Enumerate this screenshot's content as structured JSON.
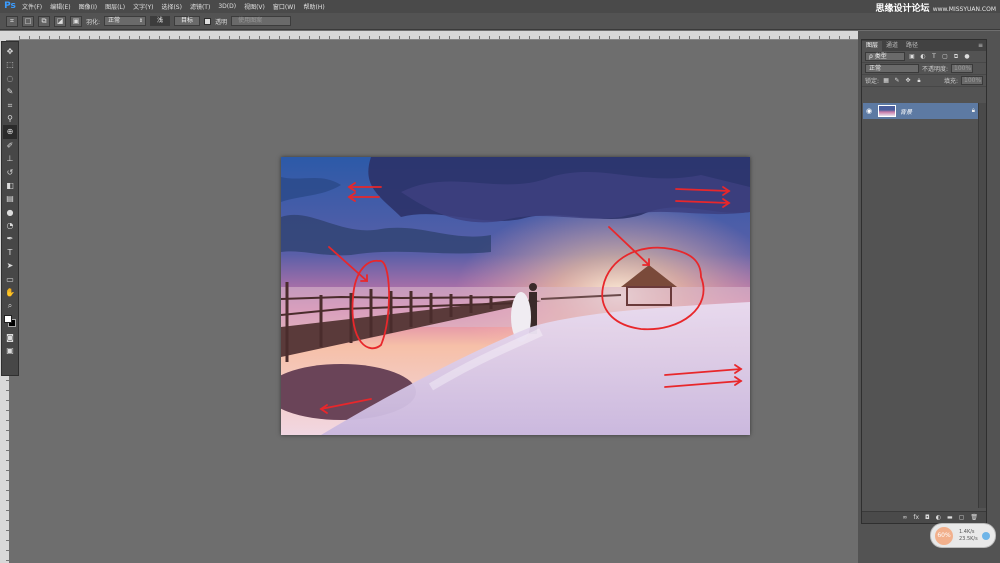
{
  "app": {
    "logo": "Ps"
  },
  "menu": [
    "文件(F)",
    "编辑(E)",
    "图像(I)",
    "图层(L)",
    "文字(Y)",
    "选择(S)",
    "滤镜(T)",
    "3D(D)",
    "视图(V)",
    "窗口(W)",
    "帮助(H)"
  ],
  "watermark": {
    "text": "思缘设计论坛",
    "url": "www.MISSYUAN.COM"
  },
  "options": {
    "feather_label": "羽化:",
    "mode_value": "正常",
    "btn_shallow": "浅",
    "btn_target": "目标",
    "transparent_label": "透明",
    "use_pattern": "使用图案"
  },
  "layers_panel": {
    "tabs": [
      "图层",
      "通道",
      "路径"
    ],
    "filter_type": "ρ 类型",
    "blend_mode": "正常",
    "opacity_label": "不透明度:",
    "opacity_value": "100%",
    "lock_label": "锁定:",
    "fill_label": "填充:",
    "fill_value": "100%",
    "layer_name": "背景"
  },
  "speed_widget": {
    "percent": "60%",
    "up": "1.4K/s",
    "down": "23.5K/s"
  },
  "colors": {
    "selected_layer": "#5d7aa3",
    "annotation": "#e8272b",
    "ps_blue": "#3b9cff"
  }
}
